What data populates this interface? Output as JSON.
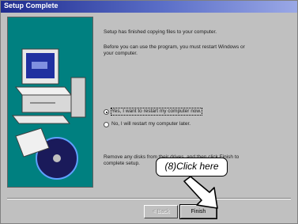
{
  "window": {
    "title": "Setup Complete"
  },
  "body": {
    "line1": "Setup has finished copying files to your computer.",
    "line2a": "Before you can use the program, you must restart Windows or",
    "line2b": "your computer.",
    "line3a": "Remove any disks from their drives, and then click Finish to",
    "line3b": "complete setup."
  },
  "options": [
    {
      "label": "Yes, I want to restart my computer now.",
      "selected": true
    },
    {
      "label": "No, I will restart my computer later.",
      "selected": false
    }
  ],
  "buttons": {
    "back": "< Back",
    "finish": "Finish"
  },
  "annotation": {
    "label": "(8)Click here"
  },
  "colors": {
    "title_start": "#1f2c8f",
    "panel": "#008080",
    "dialog": "#c0c0c0"
  }
}
